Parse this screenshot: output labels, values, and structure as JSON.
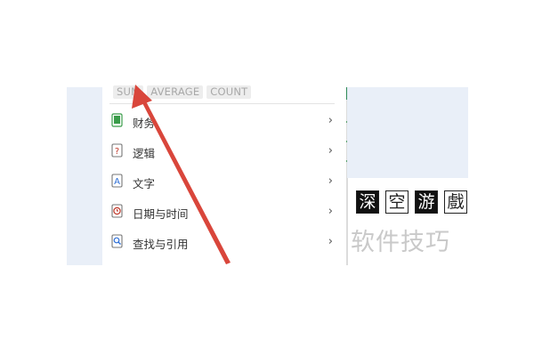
{
  "quick_functions": [
    "SUM",
    "AVERAGE",
    "COUNT"
  ],
  "menu": {
    "items": [
      {
        "label": "财务",
        "icon": "finance-book-icon",
        "icon_color": "#3a9c4a"
      },
      {
        "label": "逻辑",
        "icon": "logic-question-icon",
        "icon_color": "#c0392b"
      },
      {
        "label": "文字",
        "icon": "text-a-icon",
        "icon_color": "#2e6fd6"
      },
      {
        "label": "日期与时间",
        "icon": "clock-icon",
        "icon_color": "#c0392b"
      },
      {
        "label": "查找与引用",
        "icon": "search-icon",
        "icon_color": "#2e6fd6"
      }
    ],
    "chevron": "›"
  },
  "watermark": {
    "boxes": [
      "深",
      "空",
      "游",
      "戲"
    ],
    "text": "软件技巧"
  },
  "colors": {
    "arrow": "#d9463b",
    "panel_bg": "#e9eff8"
  }
}
